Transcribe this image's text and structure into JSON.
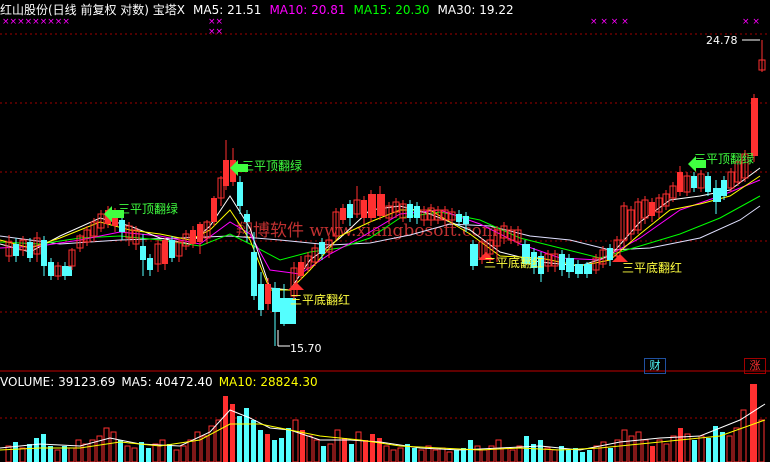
{
  "header": {
    "title": "红山股份(日线 前复权 对数) 宝塔X",
    "ma5": "MA5: 21.51",
    "ma10": "MA10: 20.81",
    "ma15": "MA15: 20.30",
    "ma30": "MA30: 19.22"
  },
  "volume_header": {
    "volume": "VOLUME: 39123.69",
    "ma5": "MA5: 40472.40",
    "ma10": "MA10: 28824.30"
  },
  "annotations": {
    "high_price": "24.78",
    "low_price": "15.70",
    "signal_top_1": "三平顶翻绿",
    "signal_top_2": "三平顶翻绿",
    "signal_top_3": "三平顶翻绿",
    "signal_bottom_1": "三平底翻红",
    "signal_bottom_2": "三平底翻红",
    "signal_bottom_3": "三平底翻红",
    "watermark": "翔博软件 www.xiangbosoft.com",
    "badge_cai": "财",
    "badge_zhang": "涨"
  },
  "colors": {
    "up": "#ff3030",
    "down": "#54ffff",
    "ma5": "#ffffff",
    "ma10": "#ffff00",
    "ma15": "#ff00ff",
    "ma30": "#00ff00",
    "ma_long": "#e0e0ff",
    "grid": "#a00000",
    "signal_green": "#40ff40",
    "signal_yellow": "#ffff40"
  }
}
